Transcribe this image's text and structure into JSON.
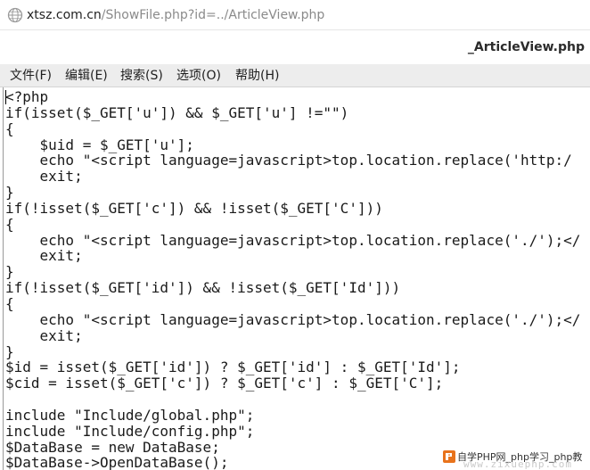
{
  "browser": {
    "address_host": "xtsz.com.cn",
    "address_path": "/ShowFile.php?id=../ArticleView.php"
  },
  "window": {
    "title": "_ArticleView.php"
  },
  "menu": {
    "items": [
      {
        "label": "文件(F)"
      },
      {
        "label": "编辑(E)"
      },
      {
        "label": "搜索(S)"
      },
      {
        "label": "选项(O)"
      },
      {
        "label": "帮助(H)"
      }
    ]
  },
  "code_lines": [
    "<?php",
    "if(isset($_GET['u']) && $_GET['u'] !=\"\")",
    "{",
    "    $uid = $_GET['u'];",
    "    echo \"<script language=javascript>top.location.replace('http:/",
    "    exit;",
    "}",
    "if(!isset($_GET['c']) && !isset($_GET['C']))",
    "{",
    "    echo \"<script language=javascript>top.location.replace('./');</",
    "    exit;",
    "}",
    "if(!isset($_GET['id']) && !isset($_GET['Id']))",
    "{",
    "    echo \"<script language=javascript>top.location.replace('./');</",
    "    exit;",
    "}",
    "$id = isset($_GET['id']) ? $_GET['id'] : $_GET['Id'];",
    "$cid = isset($_GET['c']) ? $_GET['c'] : $_GET['C'];",
    "",
    "include \"Include/global.php\";",
    "include \"Include/config.php\";",
    "$DataBase = new DataBase;",
    "$DataBase->OpenDataBase();"
  ],
  "watermark": {
    "text": "自学PHP网_php学习_php教",
    "url": "www.zixuephp.com",
    "logo_icon": "php-logo-icon"
  }
}
